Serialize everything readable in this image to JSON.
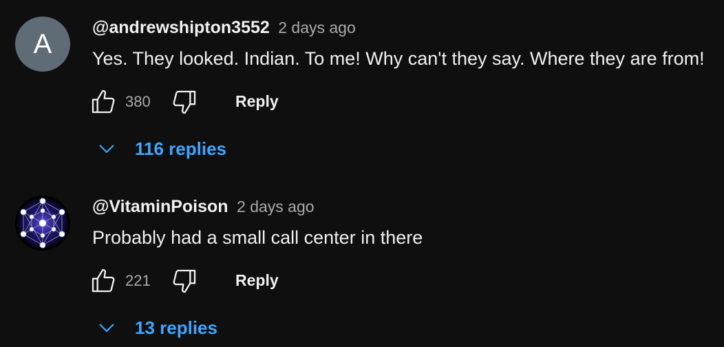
{
  "comments": [
    {
      "avatar_letter": "A",
      "author": "@andrewshipton3552",
      "time": "2 days ago",
      "text": "Yes. They looked. Indian. To me! Why can't they say. Where they are from!",
      "likes": "380",
      "reply_label": "Reply",
      "replies_label": "116 replies"
    },
    {
      "author": "@VitaminPoison",
      "time": "2 days ago",
      "text": "Probably had a small call center in there",
      "likes": "221",
      "reply_label": "Reply",
      "replies_label": "13 replies"
    }
  ],
  "colors": {
    "background": "#0f0f0f",
    "text": "#f1f1f1",
    "muted": "#aaaaaa",
    "link": "#3ea6ff",
    "avatar_bg": "#5f6b75"
  },
  "icons": [
    "thumbs-up-icon",
    "thumbs-down-icon",
    "chevron-down-icon"
  ]
}
